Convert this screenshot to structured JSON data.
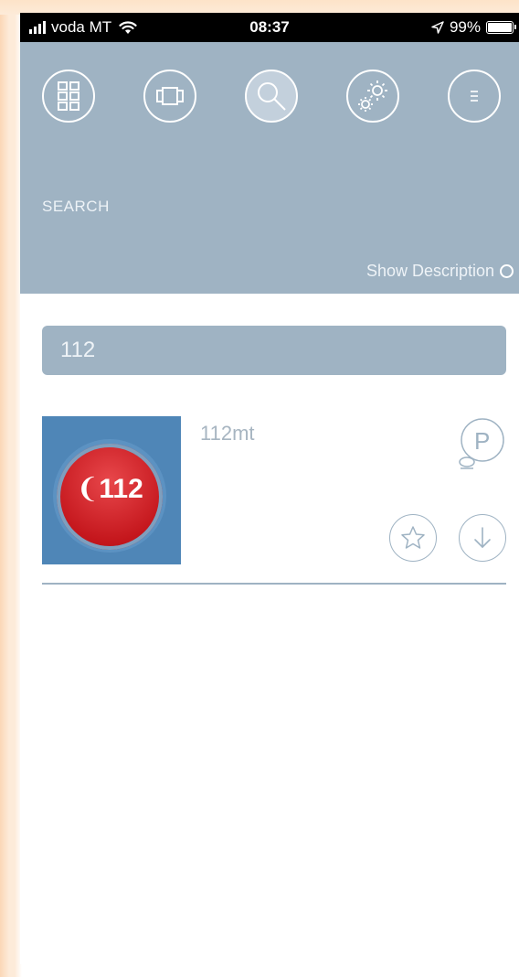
{
  "status_bar": {
    "carrier": "voda MT",
    "time": "08:37",
    "battery": "99%"
  },
  "header": {
    "nav_icons": [
      "grid-icon",
      "carousel-icon",
      "search-icon",
      "settings-icon",
      "menu-icon"
    ],
    "active_nav": "search-icon",
    "section_label": "SEARCH",
    "show_description_label": "Show Description"
  },
  "search": {
    "value": "112"
  },
  "results": [
    {
      "thumbnail_text": "112",
      "title": "112mt",
      "badge_letter": "P"
    }
  ],
  "colors": {
    "header_bg": "#9fb3c3",
    "thumbnail_bg": "#4f86b7",
    "badge_red": "#c4161c"
  }
}
